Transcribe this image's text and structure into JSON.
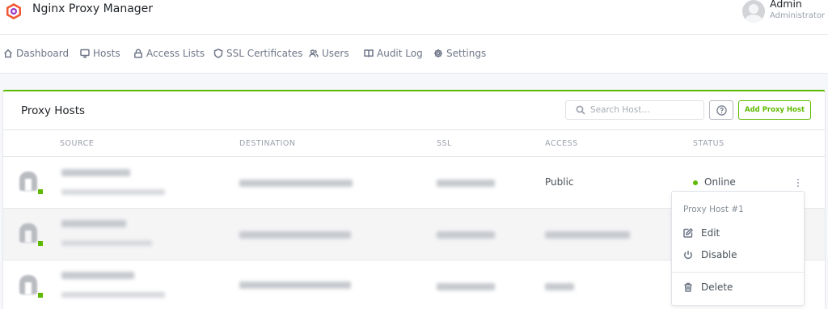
{
  "app": {
    "title": "Nginx Proxy Manager"
  },
  "user": {
    "name": "Admin",
    "role": "Administrator"
  },
  "nav": [
    {
      "label": "Dashboard",
      "icon": "home-icon"
    },
    {
      "label": "Hosts",
      "icon": "monitor-icon"
    },
    {
      "label": "Access Lists",
      "icon": "lock-icon"
    },
    {
      "label": "SSL Certificates",
      "icon": "shield-icon"
    },
    {
      "label": "Users",
      "icon": "users-icon"
    },
    {
      "label": "Audit Log",
      "icon": "book-icon"
    },
    {
      "label": "Settings",
      "icon": "gear-icon"
    }
  ],
  "card": {
    "title": "Proxy Hosts",
    "search_placeholder": "Search Host…",
    "add_label": "Add Proxy Host"
  },
  "columns": [
    "SOURCE",
    "DESTINATION",
    "SSL",
    "ACCESS",
    "STATUS"
  ],
  "rows": [
    {
      "access": "Public",
      "status": "Online"
    }
  ],
  "dropdown": {
    "header": "Proxy Host #1",
    "edit": "Edit",
    "disable": "Disable",
    "delete": "Delete"
  },
  "colors": {
    "accent": "#5eba00",
    "online": "#5eba00"
  }
}
